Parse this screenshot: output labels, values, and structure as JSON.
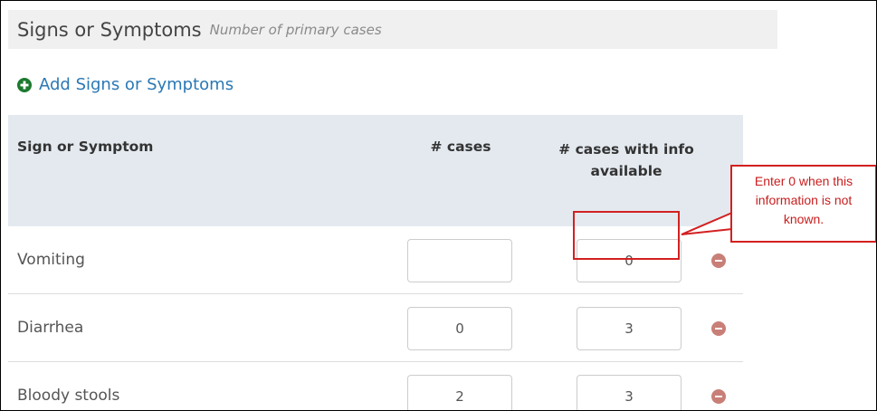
{
  "panel": {
    "title": "Signs or Symptoms",
    "subtitle": "Number of primary cases"
  },
  "add_link": {
    "label": "Add Signs or Symptoms",
    "icon": "plus-circle-icon",
    "color": "#2a78b5"
  },
  "table": {
    "headers": {
      "sign": "Sign or Symptom",
      "cases": "# cases",
      "info_line1": "# cases with info",
      "info_line2": "available"
    },
    "rows": [
      {
        "label": "Vomiting",
        "cases": "",
        "info": "0"
      },
      {
        "label": "Diarrhea",
        "cases": "0",
        "info": "3"
      },
      {
        "label": "Bloody stools",
        "cases": "2",
        "info": "3"
      }
    ]
  },
  "annotation": {
    "line1": "Enter 0 when this",
    "line2": "information is not",
    "line3": "known.",
    "color": "#d32020"
  },
  "colors": {
    "header_bg": "#f0f0f0",
    "table_header_bg": "#e3e9ef",
    "remove_icon": "#c87f77"
  }
}
